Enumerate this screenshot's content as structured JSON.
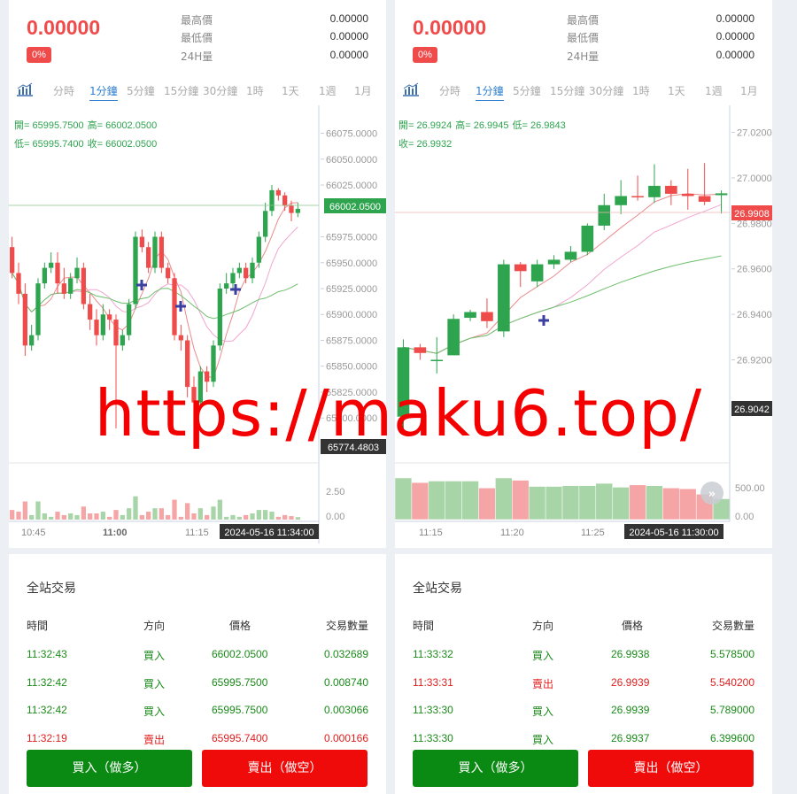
{
  "left": {
    "price": "0.00000",
    "change_pct": "0%",
    "stats": [
      {
        "label": "最高價",
        "value": "0.00000"
      },
      {
        "label": "最低價",
        "value": "0.00000"
      },
      {
        "label": "24H量",
        "value": "0.00000"
      }
    ],
    "tabs": [
      "分時",
      "1分鐘",
      "5分鐘",
      "15分鐘",
      "30分鐘",
      "1時",
      "1天",
      "1週",
      "1月"
    ],
    "active_tab": "1分鐘",
    "ohlc_line1": {
      "open": "開= 65995.7500",
      "high": "高= 66002.0500"
    },
    "ohlc_line2": {
      "low": "低= 65995.7400",
      "close": "收= 66002.0500"
    },
    "price_axis": [
      "66075.0000",
      "66050.0000",
      "66025.0000",
      "65975.0000",
      "65950.0000",
      "65925.0000",
      "65900.0000",
      "65875.0000",
      "65850.0000",
      "65825.0000",
      "65800.0000"
    ],
    "last_price_tag": "66002.0500",
    "crosshair_price_tag": "65774.4803",
    "volume_axis": [
      "2.50",
      "0.00"
    ],
    "time_axis": [
      "10:45",
      "11:00",
      "11:15"
    ],
    "crosshair_time": "2024-05-16 11:34:00",
    "trades_title": "全站交易",
    "trades_headers": [
      "時間",
      "方向",
      "價格",
      "交易數量"
    ],
    "trades": [
      {
        "time": "11:32:43",
        "side": "買入",
        "price": "66002.0500",
        "qty": "0.032689",
        "type": "buy"
      },
      {
        "time": "11:32:42",
        "side": "買入",
        "price": "65995.7500",
        "qty": "0.008740",
        "type": "buy"
      },
      {
        "time": "11:32:42",
        "side": "買入",
        "price": "65995.7500",
        "qty": "0.003066",
        "type": "buy"
      },
      {
        "time": "11:32:19",
        "side": "賣出",
        "price": "65995.7400",
        "qty": "0.000166",
        "type": "sell"
      }
    ],
    "buy_button": "買入（做多）",
    "sell_button": "賣出（做空）"
  },
  "right": {
    "price": "0.00000",
    "change_pct": "0%",
    "stats": [
      {
        "label": "最高價",
        "value": "0.00000"
      },
      {
        "label": "最低價",
        "value": "0.00000"
      },
      {
        "label": "24H量",
        "value": "0.00000"
      }
    ],
    "tabs": [
      "分時",
      "1分鐘",
      "5分鐘",
      "15分鐘",
      "30分鐘",
      "1時",
      "1天",
      "1週",
      "1月"
    ],
    "active_tab": "1分鐘",
    "ohlc_line1": {
      "open": "開= 26.9924",
      "high": "高= 26.9945",
      "low": "低= 26.9843"
    },
    "ohlc_line2": {
      "close": "收= 26.9932"
    },
    "price_axis": [
      "27.0200",
      "27.0000",
      "26.9800",
      "26.9600",
      "26.9400",
      "26.9200",
      "26.9000"
    ],
    "last_price_tag": "26.9908",
    "crosshair_price_tag": "26.9042",
    "volume_axis": [
      "500.00",
      "0.00"
    ],
    "time_axis": [
      "11:15",
      "11:20",
      "11:25"
    ],
    "crosshair_time": "2024-05-16 11:30:00",
    "trades_title": "全站交易",
    "trades_headers": [
      "時間",
      "方向",
      "價格",
      "交易數量"
    ],
    "trades": [
      {
        "time": "11:33:32",
        "side": "買入",
        "price": "26.9938",
        "qty": "5.578500",
        "type": "buy"
      },
      {
        "time": "11:33:31",
        "side": "賣出",
        "price": "26.9939",
        "qty": "5.540200",
        "type": "sell"
      },
      {
        "time": "11:33:30",
        "side": "買入",
        "price": "26.9939",
        "qty": "5.789000",
        "type": "buy"
      },
      {
        "time": "11:33:30",
        "side": "買入",
        "price": "26.9937",
        "qty": "6.399600",
        "type": "buy"
      }
    ],
    "buy_button": "買入（做多）",
    "sell_button": "賣出（做空）"
  },
  "watermark": "https://maku6.top/",
  "colors": {
    "up": "#2ea44f",
    "down": "#ef4b4b",
    "accent": "#2f80d1",
    "buy_btn": "#0a8a12",
    "sell_btn": "#f00b0b"
  },
  "chart_data": [
    {
      "type": "candlestick",
      "title": "",
      "ylim": [
        65760,
        66090
      ],
      "x": [
        "10:41",
        "10:42",
        "10:43",
        "10:44",
        "10:45",
        "10:46",
        "10:47",
        "10:48",
        "10:49",
        "10:50",
        "10:51",
        "10:52",
        "10:53",
        "10:54",
        "10:55",
        "10:56",
        "10:57",
        "10:58",
        "10:59",
        "11:00",
        "11:01",
        "11:02",
        "11:03",
        "11:04",
        "11:05",
        "11:06",
        "11:07",
        "11:08",
        "11:09",
        "11:10",
        "11:11",
        "11:12",
        "11:13",
        "11:14",
        "11:15",
        "11:16",
        "11:17",
        "11:18",
        "11:19",
        "11:20",
        "11:21",
        "11:22",
        "11:23",
        "11:24",
        "11:25",
        "11:26",
        "11:27",
        "11:28",
        "11:29",
        "11:30",
        "11:31",
        "11:32",
        "11:33",
        "11:34"
      ],
      "open": [
        65965,
        65940,
        65920,
        65870,
        65880,
        65930,
        65945,
        65950,
        65930,
        65920,
        65935,
        65945,
        65910,
        65895,
        65880,
        65900,
        65895,
        65870,
        65880,
        65910,
        65975,
        65965,
        65945,
        65975,
        65945,
        65935,
        65880,
        65875,
        65830,
        65815,
        65845,
        65835,
        65870,
        65925,
        65930,
        65940,
        65945,
        65935,
        65950,
        65975,
        66000,
        66020,
        66015,
        66005,
        65998
      ],
      "close": [
        65940,
        65920,
        65870,
        65880,
        65930,
        65945,
        65950,
        65930,
        65920,
        65935,
        65945,
        65910,
        65895,
        65880,
        65900,
        65895,
        65870,
        65880,
        65910,
        65975,
        65965,
        65945,
        65975,
        65945,
        65935,
        65880,
        65875,
        65830,
        65815,
        65845,
        65835,
        65870,
        65925,
        65930,
        65940,
        65945,
        65935,
        65950,
        65975,
        66000,
        66020,
        66015,
        66005,
        65998,
        66002
      ],
      "high": [
        65975,
        65950,
        65930,
        65890,
        65935,
        65950,
        65960,
        65960,
        65945,
        65940,
        65955,
        65950,
        65920,
        65905,
        65910,
        65905,
        65900,
        65885,
        65915,
        65980,
        65982,
        65970,
        65980,
        65980,
        65950,
        65940,
        65890,
        65880,
        65840,
        65850,
        65850,
        65875,
        65930,
        65940,
        65945,
        65950,
        65950,
        65955,
        65980,
        66008,
        66025,
        66022,
        66018,
        66010,
        66008
      ],
      "low": [
        65935,
        65910,
        65860,
        65865,
        65875,
        65925,
        65940,
        65920,
        65915,
        65915,
        65930,
        65905,
        65885,
        65870,
        65875,
        65885,
        65790,
        65865,
        65875,
        65905,
        65960,
        65940,
        65940,
        65940,
        65930,
        65875,
        65865,
        65820,
        65800,
        65810,
        65825,
        65830,
        65865,
        65920,
        65925,
        65935,
        65930,
        65930,
        65945,
        65970,
        65995,
        66010,
        66000,
        65990,
        65994
      ],
      "volume_ylim": [
        0,
        3.5
      ]
    },
    {
      "type": "candlestick",
      "title": "",
      "ylim": [
        26.884,
        27.028
      ],
      "x": [
        "11:11",
        "11:12",
        "11:13",
        "11:14",
        "11:15",
        "11:16",
        "11:17",
        "11:18",
        "11:19",
        "11:20",
        "11:21",
        "11:22",
        "11:23",
        "11:24",
        "11:25",
        "11:26",
        "11:27",
        "11:28",
        "11:29",
        "11:30"
      ],
      "open": [
        26.895,
        26.9255,
        26.92,
        26.922,
        26.9385,
        26.941,
        26.9325,
        26.962,
        26.9545,
        26.962,
        26.964,
        26.9675,
        26.979,
        26.988,
        26.992,
        26.9915,
        26.9965,
        26.993,
        26.992,
        26.9924
      ],
      "close": [
        26.9255,
        26.923,
        26.92,
        26.938,
        26.941,
        26.937,
        26.962,
        26.959,
        26.962,
        26.964,
        26.9675,
        26.979,
        26.988,
        26.992,
        26.9915,
        26.9965,
        26.993,
        26.992,
        26.9895,
        26.9932
      ],
      "high": [
        26.929,
        26.927,
        26.93,
        26.94,
        26.942,
        26.947,
        26.964,
        26.963,
        26.964,
        26.966,
        26.97,
        26.98,
        26.993,
        26.999,
        27.001,
        27.006,
        26.999,
        27.004,
        27.0065,
        26.9945
      ],
      "low": [
        26.887,
        26.92,
        26.914,
        26.922,
        26.937,
        26.934,
        26.93,
        26.952,
        26.952,
        26.96,
        26.963,
        26.966,
        26.977,
        26.984,
        26.99,
        26.989,
        26.988,
        26.986,
        26.988,
        26.9843
      ],
      "volume": [
        540,
        480,
        500,
        500,
        500,
        410,
        540,
        510,
        430,
        430,
        440,
        440,
        470,
        420,
        450,
        440,
        410,
        400,
        330,
        270
      ],
      "volume_ylim": [
        0,
        620
      ]
    }
  ]
}
